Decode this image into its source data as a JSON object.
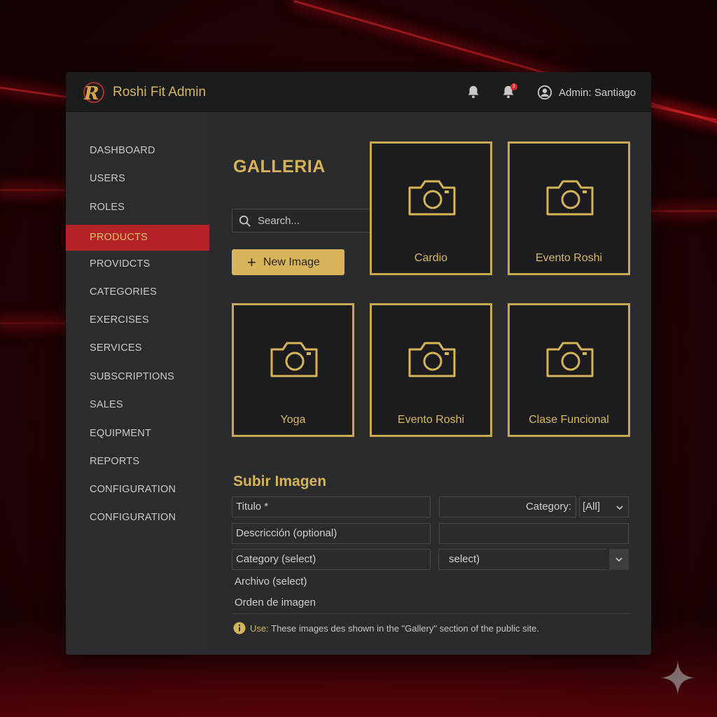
{
  "app": {
    "title": "Roshi Fit Admin",
    "logo_letter": "R",
    "brand_color": "#d7b356",
    "accent_color": "#b52228"
  },
  "header": {
    "icons": [
      "bell-icon",
      "bell-notification-icon",
      "user-circle-icon"
    ],
    "notification_count": "1",
    "user_label": "Admin: Santiago"
  },
  "sidebar": {
    "items": [
      {
        "label": "DASHBOARD"
      },
      {
        "label": "USERS"
      },
      {
        "label": "ROLES"
      },
      {
        "label": "PRODUCTS",
        "active": true
      },
      {
        "label": "PROVIDCTS"
      },
      {
        "label": "CATEGORIES"
      },
      {
        "label": "EXERCISES"
      },
      {
        "label": "SERVICES"
      },
      {
        "label": "SUBSCRIPTIONS"
      },
      {
        "label": "SALES"
      },
      {
        "label": "EQUIPMENT"
      },
      {
        "label": "REPORTS"
      },
      {
        "label": "CONFIGURATION"
      },
      {
        "label": "CONFIGURATION"
      }
    ]
  },
  "gallery": {
    "title": "GALLERIA",
    "search_placeholder": "Search...",
    "new_button": "New Image",
    "tiles": [
      {
        "label": "Cardio",
        "icon": "camera-icon"
      },
      {
        "label": "Evento Roshi",
        "icon": "camera-icon"
      },
      {
        "label": "Yoga",
        "icon": "camera-icon"
      },
      {
        "label": "Evento Roshi",
        "icon": "camera-icon"
      },
      {
        "label": "Clase Funcional",
        "icon": "camera-icon"
      }
    ]
  },
  "upload": {
    "title": "Subir Imagen",
    "titulo_field": "Titulo *",
    "descripcion_field": "Descricción (optional)",
    "category_field": "Category (select)",
    "archivo_label": "Archivo (select)",
    "orden_label": "Orden de imagen",
    "category_filter_label": "Category:",
    "category_filter_value": "[All]",
    "select_value": "select)"
  },
  "info": {
    "prefix": "Use:",
    "text": "These images des shown in the \"Gallery\" section of the public site."
  }
}
